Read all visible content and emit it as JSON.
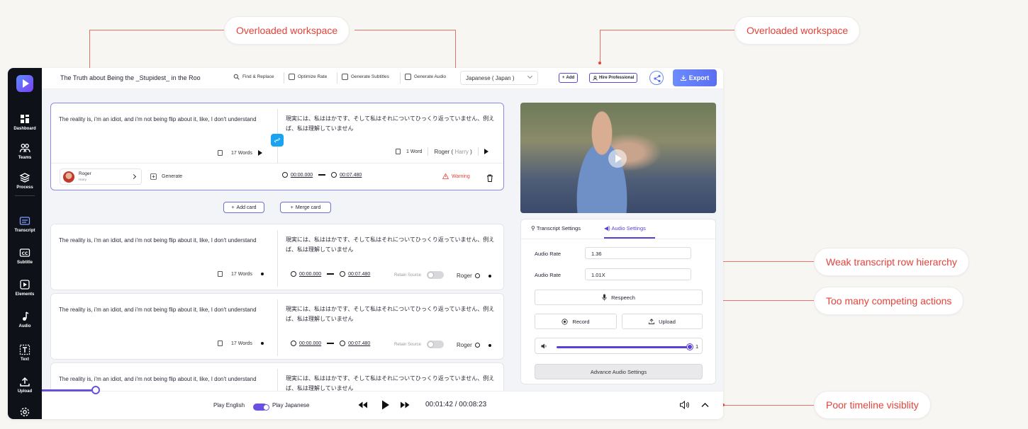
{
  "annotations": {
    "workspace_left": "Overloaded workspace",
    "workspace_right": "Overloaded workspace",
    "transcript_hierarchy": "Weak transcript row hierarchy",
    "competing_actions": "Too many competing actions",
    "timeline": "Poor timeline visiblity"
  },
  "sidebar": {
    "items": [
      {
        "label": "Dashboard",
        "icon": "dashboard-icon"
      },
      {
        "label": "Teams",
        "icon": "teams-icon"
      },
      {
        "label": "Process",
        "icon": "process-icon"
      },
      {
        "label": "Transcript",
        "icon": "transcript-icon"
      },
      {
        "label": "Subtitle",
        "icon": "subtitle-icon"
      },
      {
        "label": "Elements",
        "icon": "elements-icon"
      },
      {
        "label": "Audio",
        "icon": "audio-icon"
      },
      {
        "label": "Text",
        "icon": "text-icon"
      },
      {
        "label": "Upload",
        "icon": "upload-icon"
      }
    ],
    "settings_icon": "gear-icon"
  },
  "topbar": {
    "title": "The Truth about Being the _Stupidest_ in the Roo",
    "tools": [
      "Find & Replace",
      "Optimize Rate",
      "Generate Subtitles",
      "Generate Audio"
    ],
    "language": "Japanese ( Japan )",
    "add": "Add",
    "hire": "Hire Professional",
    "export": "Export"
  },
  "active_card": {
    "source": "The reality is, i'm an idiot, and i'm not being flip about it, like, I don't understand",
    "target": "現実には、私ははかです、そして私はそれについてひっくり返っていません、例えば、私は理解していません",
    "source_words": "17 Words",
    "target_words": "1 Word",
    "speaker_primary": "Roger",
    "speaker_secondary": "Harry",
    "speaker_sep": "(",
    "speaker_end": ")",
    "avatar_name": "Roger",
    "avatar_sub": "Harry",
    "generate": "Generate",
    "start": "00:00.000",
    "end": "00:07.480",
    "warning": "Warning"
  },
  "card_actions": {
    "add": "Add card",
    "merge": "Merge card"
  },
  "cards": [
    {
      "source": "The reality is, i'm an idiot, and i'm not being flip about it, like, I don't understand",
      "target": "現実には、私ははかです、そして私はそれについてひっくり返っていません、例えば、私は理解していません",
      "words": "17 Words",
      "start": "00:00.000",
      "end": "00:07.480",
      "retain": "Retain Source",
      "speaker": "Roger"
    },
    {
      "source": "The reality is, i'm an idiot, and i'm not being flip about it, like, I don't understand",
      "target": "現実には、私ははかです、そして私はそれについてひっくり返っていません、例えば、私は理解していません",
      "words": "17 Words",
      "start": "00:00.000",
      "end": "00:07.480",
      "retain": "Retain Source",
      "speaker": "Roger"
    },
    {
      "source": "The reality is, i'm an idiot, and i'm not being flip about it, like, I don't understand",
      "target": "現実には、私ははかです、そして私はそれについてひっくり返っていません、例えば、私は理解していません"
    }
  ],
  "settings": {
    "tab_transcript": "Transcript Settings",
    "tab_audio": "Audio Settings",
    "audio_rate_label": "Audio Rate",
    "audio_rate_1": "1.36",
    "audio_rate_2": "1.01X",
    "respeech": "Respeech",
    "record": "Record",
    "upload": "Upload",
    "volume_value": "1",
    "volume_level": 1.0,
    "advanced": "Advance Audio Settings"
  },
  "player": {
    "play_english": "Play English",
    "play_japanese": "Play Japanese",
    "current": "00:01:42",
    "separator": "/",
    "total": "00:08:23"
  },
  "colors": {
    "accent": "#5b3fd8",
    "annotation": "#e5423a",
    "export": "#6b8cff",
    "sidebar": "#0f1118"
  }
}
